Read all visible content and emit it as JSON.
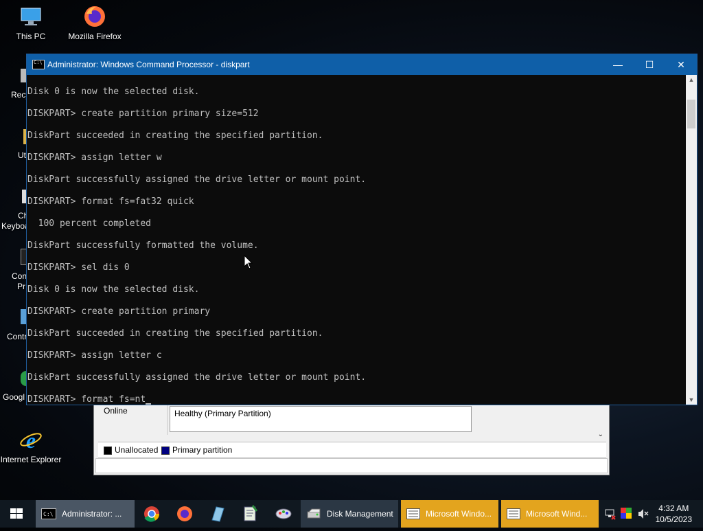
{
  "desktop": {
    "icons": [
      {
        "label": "This PC",
        "icon": "this-pc-icon"
      },
      {
        "label": "Mozilla Firefox",
        "icon": "firefox-icon"
      },
      {
        "label": "Internet Explorer",
        "icon": "internet-explorer-icon"
      }
    ],
    "partial_labels": [
      "Recy",
      "Ut",
      "Ch",
      "Keyboa",
      "Con",
      "Pr",
      "Contr",
      "Googl"
    ]
  },
  "disk_management": {
    "disk_status": "Online",
    "partition_status": "Healthy (Primary Partition)",
    "legend": [
      {
        "label": "Unallocated",
        "color": "#000000"
      },
      {
        "label": "Primary partition",
        "color": "#000080"
      }
    ]
  },
  "cmd_window": {
    "title": "Administrator: Windows Command Processor - diskpart",
    "controls": {
      "minimize": "—",
      "maximize": "☐",
      "close": "✕"
    },
    "lines": [
      "Disk 0 is now the selected disk.",
      "",
      "DISKPART> create partition primary size=512",
      "",
      "DiskPart succeeded in creating the specified partition.",
      "",
      "DISKPART> assign letter w",
      "",
      "DiskPart successfully assigned the drive letter or mount point.",
      "",
      "DISKPART> format fs=fat32 quick",
      "",
      "  100 percent completed",
      "",
      "DiskPart successfully formatted the volume.",
      "",
      "DISKPART> sel dis 0",
      "",
      "Disk 0 is now the selected disk.",
      "",
      "DISKPART> create partition primary",
      "",
      "DiskPart succeeded in creating the specified partition.",
      "",
      "DISKPART> assign letter c",
      "",
      "DiskPart successfully assigned the drive letter or mount point.",
      "",
      "DISKPART> format fs=nt"
    ]
  },
  "taskbar": {
    "apps": [
      {
        "label": "Administrator: ...",
        "icon": "cmd-icon",
        "active": true
      },
      {
        "label": "",
        "icon": "chrome-icon"
      },
      {
        "label": "",
        "icon": "firefox-icon"
      },
      {
        "label": "",
        "icon": "notebook-icon"
      },
      {
        "label": "",
        "icon": "notepad-icon"
      },
      {
        "label": "",
        "icon": "paint-icon"
      },
      {
        "label": "Disk Management",
        "icon": "disk-management-icon"
      },
      {
        "label": "Microsoft Windo...",
        "icon": "window-list-icon"
      },
      {
        "label": "Microsoft Wind...",
        "icon": "window-list-icon"
      }
    ],
    "clock_time": "4:32 AM",
    "clock_date": "10/5/2023"
  }
}
